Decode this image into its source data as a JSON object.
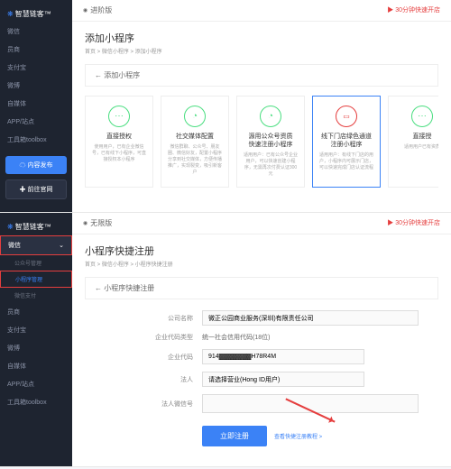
{
  "brand": "智慧链客™",
  "top": {
    "tab": "进阶版",
    "quick": "▶ 30分钟快速开店",
    "title": "添加小程序",
    "breadcrumb": "首页 > 微信小程序 > 添加小程序",
    "back": "←  添加小程序",
    "nav": [
      "微信",
      "员商",
      "支付宝",
      "微博",
      "自媒体",
      "APP/站点",
      "工具箱toolbox"
    ],
    "btn1": "☁ 内容发布",
    "btn2": "✚ 前往官网",
    "cards": [
      {
        "title": "直接授权",
        "desc": "使用用户，已有企业微信号，已有线下小程序，可直接授权本小程序"
      },
      {
        "title": "社交媒体配置",
        "desc": "微信群聊、公众号、朋友圈、微信好友，配置小程序分享到社交媒体，方便传播推广，实现裂变，吸引新客户"
      },
      {
        "title": "源用公众号资质\n快速注册小程序",
        "desc": "适用用户：已有公众号企业用户，可以快速创建小程序，无需再次付费认证300元"
      },
      {
        "title": "线下门店绿色通道\n注册小程序",
        "desc": "适用用户：有线下门店的用户，小程序内可展示门店，可以快速完成门店认证流程"
      },
      {
        "title": "直接授",
        "desc": "适用用户已有资质"
      }
    ]
  },
  "bottom": {
    "tab": "无限版",
    "quick": "▶ 30分钟快速开店",
    "title": "小程序快捷注册",
    "breadcrumb": "首页 > 微信小程序 > 小程序快捷注册",
    "back": "←  小程序快捷注册",
    "nav_main": "微信",
    "nav_subs": [
      "公众号管理",
      "小程序管理",
      "微信支付"
    ],
    "nav_rest": [
      "员商",
      "支付宝",
      "微博",
      "自媒体",
      "APP/站点",
      "工具箱toolbox"
    ],
    "form": {
      "f1_label": "公司名称",
      "f1_val": "微正公园商业服务(深圳)有限责任公司",
      "f2_label": "企业代码类型",
      "f2_val": "统一社会信用代码(18位)",
      "f3_label": "企业代码",
      "f3_val": "914▓▓▓▓▓▓▓H78R4M",
      "f4_label": "法人",
      "f4_val": "请选择营业(Hong ID用户)",
      "f5_label": "法人微信号",
      "f5_val": "",
      "submit": "立即注册",
      "help": "查看快捷注册教程 >"
    }
  }
}
